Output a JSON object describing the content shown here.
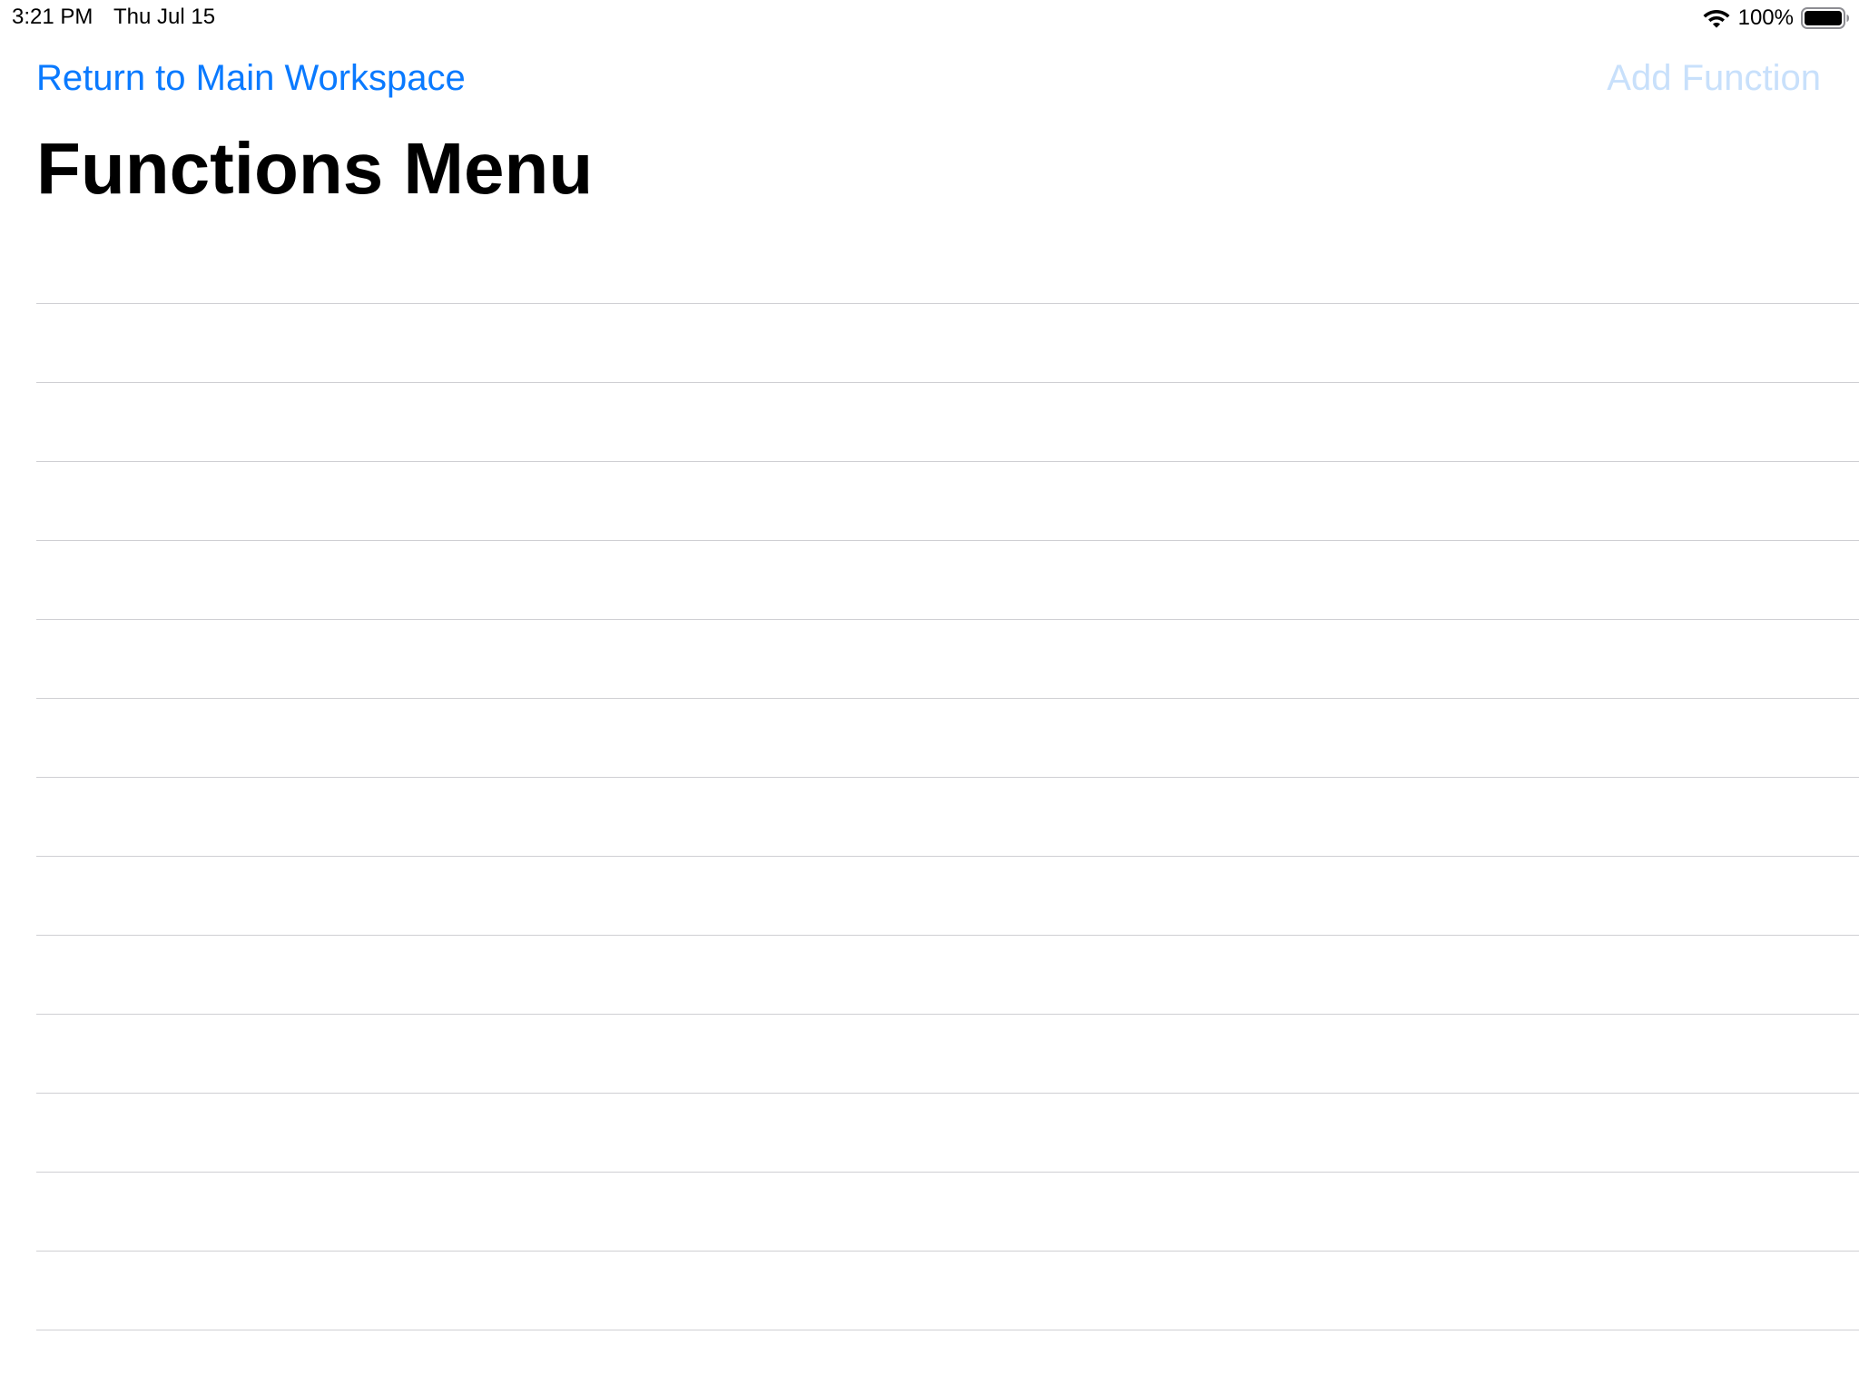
{
  "status_bar": {
    "time": "3:21 PM",
    "date": "Thu Jul 15",
    "battery_percent": "100%",
    "wifi_icon": "wifi-icon",
    "battery_icon": "battery-full-icon"
  },
  "nav": {
    "back_label": "Return to Main Workspace",
    "action_label": "Add Function",
    "action_enabled": false
  },
  "page": {
    "title": "Functions Menu"
  },
  "table": {
    "rows": [
      "",
      "",
      "",
      "",
      "",
      "",
      "",
      "",
      "",
      "",
      "",
      "",
      "",
      ""
    ]
  },
  "colors": {
    "accent": "#0a7aff",
    "disabled_accent": "#c8e0fb",
    "separator": "#cfcfd3",
    "background": "#ffffff",
    "text": "#000000"
  }
}
